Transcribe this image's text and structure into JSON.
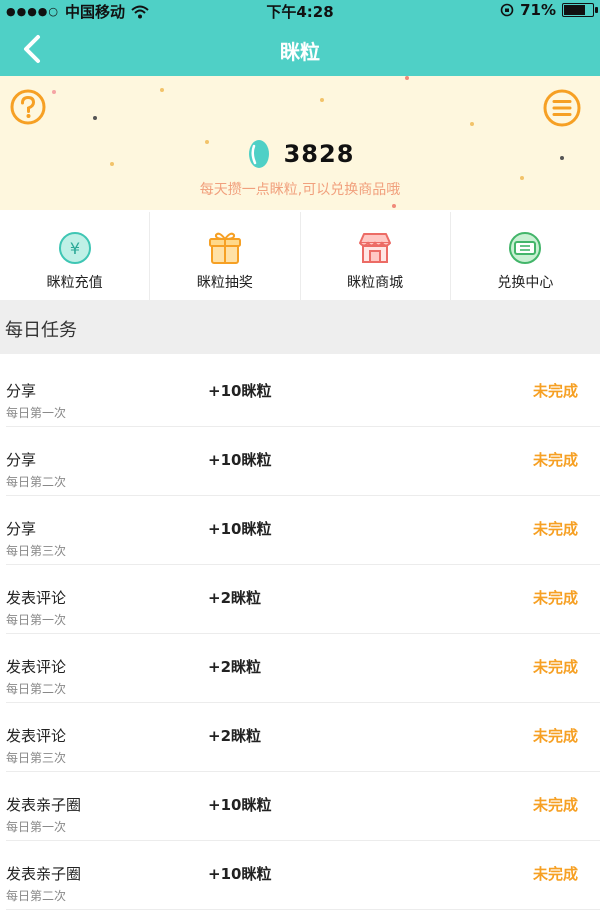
{
  "status_bar": {
    "carrier": "中国移动",
    "time": "下午4:28",
    "battery": "71%",
    "battery_level": 0.71
  },
  "nav": {
    "title": "眯粒"
  },
  "hero": {
    "points": "3828",
    "subtitle": "每天攒一点眯粒,可以兑换商品哦"
  },
  "quick_actions": [
    {
      "label": "眯粒充值",
      "icon": "yen-coin-icon"
    },
    {
      "label": "眯粒抽奖",
      "icon": "gift-box-icon"
    },
    {
      "label": "眯粒商城",
      "icon": "storefront-icon"
    },
    {
      "label": "兑换中心",
      "icon": "ticket-icon"
    }
  ],
  "tasks_section": {
    "title": "每日任务"
  },
  "tasks": [
    {
      "name": "分享",
      "frequency": "每日第一次",
      "reward": "+10眯粒",
      "status": "未完成"
    },
    {
      "name": "分享",
      "frequency": "每日第二次",
      "reward": "+10眯粒",
      "status": "未完成"
    },
    {
      "name": "分享",
      "frequency": "每日第三次",
      "reward": "+10眯粒",
      "status": "未完成"
    },
    {
      "name": "发表评论",
      "frequency": "每日第一次",
      "reward": "+2眯粒",
      "status": "未完成"
    },
    {
      "name": "发表评论",
      "frequency": "每日第二次",
      "reward": "+2眯粒",
      "status": "未完成"
    },
    {
      "name": "发表评论",
      "frequency": "每日第三次",
      "reward": "+2眯粒",
      "status": "未完成"
    },
    {
      "name": "发表亲子圈",
      "frequency": "每日第一次",
      "reward": "+10眯粒",
      "status": "未完成"
    },
    {
      "name": "发表亲子圈",
      "frequency": "每日第二次",
      "reward": "+10眯粒",
      "status": "未完成"
    }
  ],
  "colors": {
    "brand": "#4fd0c6",
    "hero_bg": "#fef7de",
    "accent_orange": "#f6a024",
    "subtitle_text": "#f1a07d"
  }
}
